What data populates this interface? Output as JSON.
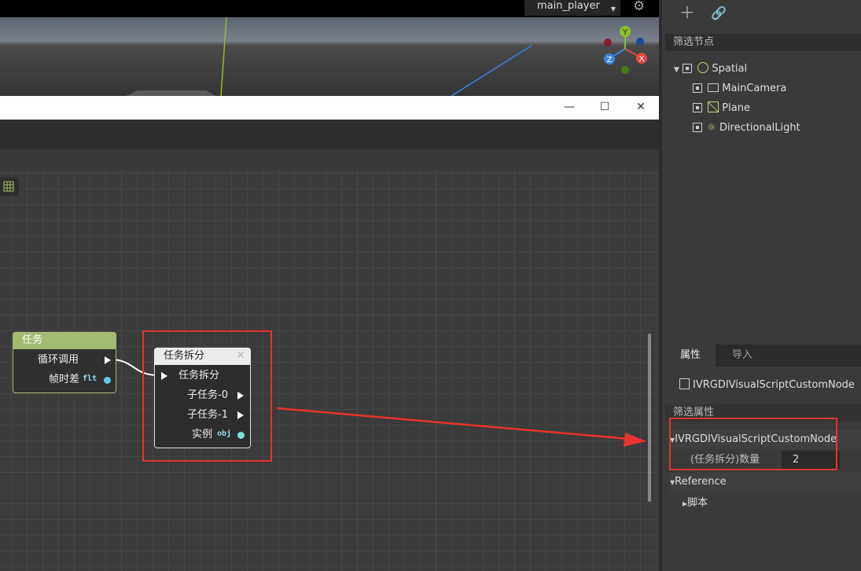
{
  "viewport": {
    "player": "main_player",
    "gizmo_axes": [
      "Y",
      "Z",
      "X"
    ]
  },
  "window": {
    "minimize": "—",
    "maximize": "☐",
    "close": "✕"
  },
  "graph": {
    "node_task": {
      "title": "任务",
      "rows": [
        {
          "label": "循环调用"
        },
        {
          "label": "帧时差",
          "type": "flt"
        }
      ]
    },
    "node_split": {
      "title": "任务拆分",
      "close": "✕",
      "rows": [
        {
          "label": "任务拆分"
        },
        {
          "label": "子任务-0"
        },
        {
          "label": "子任务-1"
        },
        {
          "label": "实例",
          "type": "obj"
        }
      ]
    }
  },
  "dock": {
    "scene_filter_label": "筛选节点",
    "scene_tree": [
      {
        "label": "Spatial"
      },
      {
        "label": "MainCamera"
      },
      {
        "label": "Plane"
      },
      {
        "label": "DirectionalLight"
      }
    ],
    "tabs": [
      "属性",
      "导入"
    ],
    "inspected_object": "IVRGDIVisualScriptCustomNode",
    "property_filter_label": "筛选属性",
    "sections": {
      "custom_node": "IVRGDIVisualScriptCustomNode",
      "count_label": "(任务拆分)数量",
      "count_value": "2",
      "reference": "Reference",
      "script": "脚本"
    }
  },
  "colors": {
    "accent_task": "#a3bc72",
    "annotation_red": "#e8332f"
  }
}
